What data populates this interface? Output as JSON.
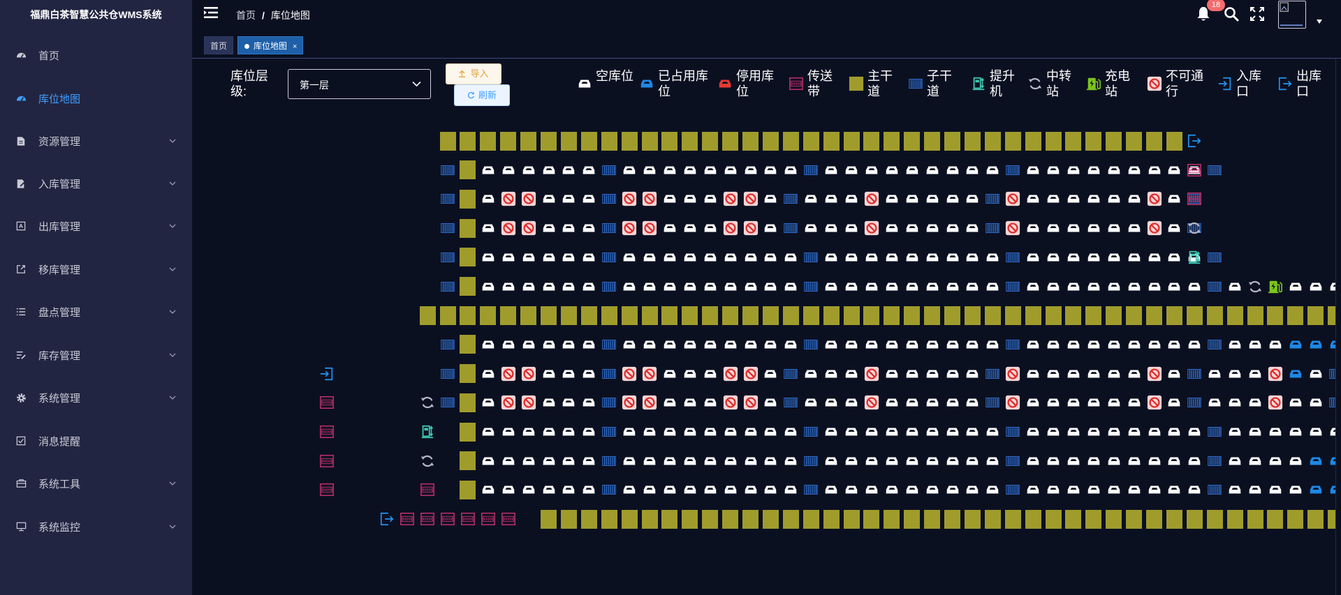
{
  "app": {
    "title": "福鼎白茶智慧公共仓WMS系统"
  },
  "sidebar": {
    "items": [
      {
        "label": "首页",
        "icon": "dashboard-icon",
        "active": false,
        "expandable": false
      },
      {
        "label": "库位地图",
        "icon": "speedometer-icon",
        "active": true,
        "expandable": false
      },
      {
        "label": "资源管理",
        "icon": "document-icon",
        "active": false,
        "expandable": true
      },
      {
        "label": "入库管理",
        "icon": "document-edit-icon",
        "active": false,
        "expandable": true
      },
      {
        "label": "出库管理",
        "icon": "export-box-icon",
        "active": false,
        "expandable": true
      },
      {
        "label": "移库管理",
        "icon": "share-icon",
        "active": false,
        "expandable": true
      },
      {
        "label": "盘点管理",
        "icon": "list-icon",
        "active": false,
        "expandable": true
      },
      {
        "label": "库存管理",
        "icon": "list-edit-icon",
        "active": false,
        "expandable": true
      },
      {
        "label": "系统管理",
        "icon": "gear-icon",
        "active": false,
        "expandable": true
      },
      {
        "label": "消息提醒",
        "icon": "checkbox-icon",
        "active": false,
        "expandable": false
      },
      {
        "label": "系统工具",
        "icon": "toolbox-icon",
        "active": false,
        "expandable": true
      },
      {
        "label": "系统监控",
        "icon": "monitor-icon",
        "active": false,
        "expandable": true
      }
    ]
  },
  "header": {
    "breadcrumb": [
      "首页",
      "库位地图"
    ],
    "notification_count": "18"
  },
  "tags": [
    {
      "label": "首页",
      "active": false,
      "closable": false
    },
    {
      "label": "库位地图",
      "active": true,
      "closable": true,
      "close_symbol": "×"
    }
  ],
  "filter": {
    "layer_label": "库位层级:",
    "layer_value": "第一层",
    "import_label": "导入",
    "refresh_label": "刷新"
  },
  "legend": [
    {
      "key": "E",
      "label": "空库位"
    },
    {
      "key": "O",
      "label": "已占用库位"
    },
    {
      "key": "D",
      "label": "停用库位"
    },
    {
      "key": "C",
      "label": "传送带"
    },
    {
      "key": "M",
      "label": "主干道"
    },
    {
      "key": "S",
      "label": "子干道"
    },
    {
      "key": "L",
      "label": "提升机"
    },
    {
      "key": "T",
      "label": "中转站"
    },
    {
      "key": "G",
      "label": "充电站"
    },
    {
      "key": "X",
      "label": "不可通行"
    },
    {
      "key": "I",
      "label": "入库口"
    },
    {
      "key": "Q",
      "label": "出库口"
    }
  ],
  "colors": {
    "background": "#0b1021",
    "sidebar": "#222541",
    "active_menu": "#409eff",
    "main_road": "#a09c2c",
    "sub_road": "#2f6fd0",
    "conveyor": "#c4306e",
    "occupied": "#1e88e5",
    "disabled": "#e53935",
    "lift": "#40c4b0",
    "charging": "#7cc51c",
    "no_pass_bg": "#f5d5d5",
    "no_pass_fg": "#e02b2b",
    "inbound_outbound": "#2196f3",
    "transfer": "#b5b8c4"
  },
  "map": {
    "rows": [
      "..........MMMMMMMMMMMMMMMMMMMMMMMMMMMMMMMMMMMMM...",
      "..........SMEEEEEESEEEEEEEEESEEEEEEEEESEEEEEEEEES..",
      "..........SMEXXEEESXXEEEXXESEEEXEEEEESXEEEEEEXES..",
      "..........SMEXXEEESXXEEEXXESEEEXEEEEESXEEEEEEXES..",
      "..........SMEEEEEESEEEEEEEEESEEEEEEEEESEEEEEEEEES..",
      "..........SMEEEEEESEEEEEEEEESEEEEEEEEESEEEEEEEEESETGEEEOOS",
      ".........MMMMMMMMMMMMMMMMMMMMMMMMMMMMMMMMMMMMMMMMMMMMMM",
      "..........SMEEEEEESEEEEEEEEESEEEEEEEEESEEEEEEEEESEEEOOOS",
      "..........SMEXXEEESXXEEEXXESEEEXEEEEESXEEEEEEXESEEEXOES",
      ".........TSMEXXEEESXXEEEXXESEEEXEEEEESXEEEEEEXESEEEXEES",
      ".........L.MEEEEEESEEEEEEEEESEEEEEEEEESEEEEEEEEESEEEEEES",
      ".........T.MEEEEEESEEEEEEEEESEEEEEEEEESEEEEEEEEESEEEEOOS",
      ".........C.MEEEEEESEEEEEEEEESEEEEEEEEESEEEEEEEEESEEEEOOS",
      ".......QCCCCCC.MMMMMMMMMMMMMMMMMMMMMMMMMMMMMMMMMMMMMMMMM"
    ],
    "extras": [
      {
        "row": 0,
        "col": 47,
        "key": "Q"
      },
      {
        "row": 1,
        "col": 47,
        "key": "C"
      },
      {
        "row": 2,
        "col": 47,
        "key": "C"
      },
      {
        "row": 3,
        "col": 47,
        "key": "T"
      },
      {
        "row": 4,
        "col": 47,
        "key": "L"
      },
      {
        "row": 8,
        "col": 4,
        "key": "I"
      },
      {
        "row": 9,
        "col": 4,
        "key": "C"
      },
      {
        "row": 10,
        "col": 4,
        "key": "C"
      },
      {
        "row": 11,
        "col": 4,
        "key": "C"
      },
      {
        "row": 12,
        "col": 4,
        "key": "C"
      }
    ]
  }
}
